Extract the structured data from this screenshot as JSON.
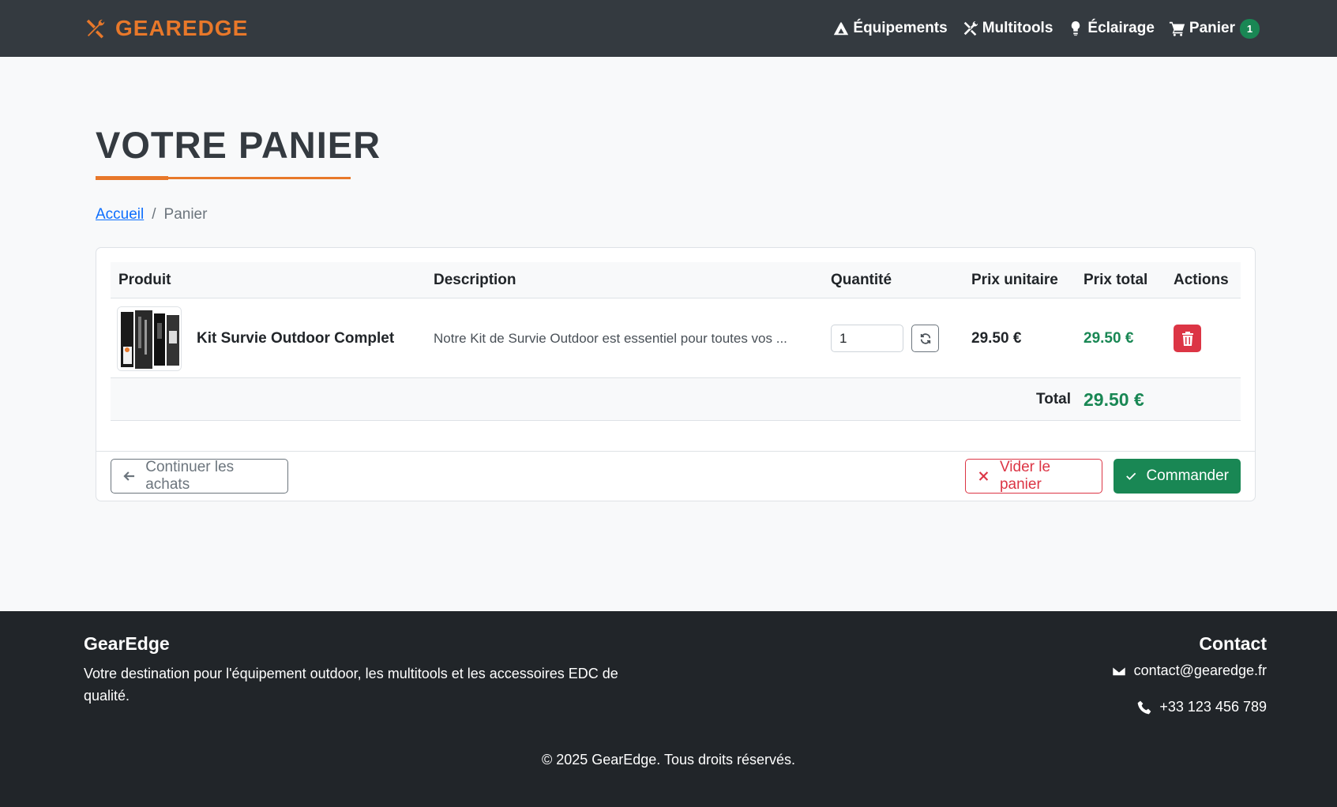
{
  "nav": {
    "brand": "GEAREDGE",
    "links": [
      {
        "label": "Équipements",
        "icon": "tent-icon"
      },
      {
        "label": "Multitools",
        "icon": "tools-icon"
      },
      {
        "label": "Éclairage",
        "icon": "lightbulb-icon"
      },
      {
        "label": "Panier",
        "icon": "cart-icon"
      }
    ],
    "cart_count": "1"
  },
  "page": {
    "title": "VOTRE PANIER",
    "breadcrumb": {
      "home": "Accueil",
      "separator": "/",
      "current": "Panier"
    }
  },
  "cart": {
    "headers": {
      "product": "Produit",
      "description": "Description",
      "quantity": "Quantité",
      "unit_price": "Prix unitaire",
      "total_price": "Prix total",
      "actions": "Actions"
    },
    "items": [
      {
        "name": "Kit Survie Outdoor Complet",
        "description": "Notre Kit de Survie Outdoor est essentiel pour toutes vos ...",
        "quantity": "1",
        "unit_price": "29.50 €",
        "total_price": "29.50 €"
      }
    ],
    "total_label": "Total",
    "total_value": "29.50 €"
  },
  "buttons": {
    "continue": "Continuer les achats",
    "clear": "Vider le panier",
    "order": "Commander"
  },
  "footer": {
    "brand": "GearEdge",
    "description": "Votre destination pour l'équipement outdoor, les multitools et les accessoires EDC de qualité.",
    "contact_title": "Contact",
    "email": "contact@gearedge.fr",
    "phone": "+33 123 456 789",
    "copyright": "© 2025 GearEdge. Tous droits réservés."
  },
  "colors": {
    "accent": "#e8782a",
    "navbar": "#343a40",
    "success": "#198754",
    "danger": "#dc3545",
    "footer": "#212529"
  }
}
